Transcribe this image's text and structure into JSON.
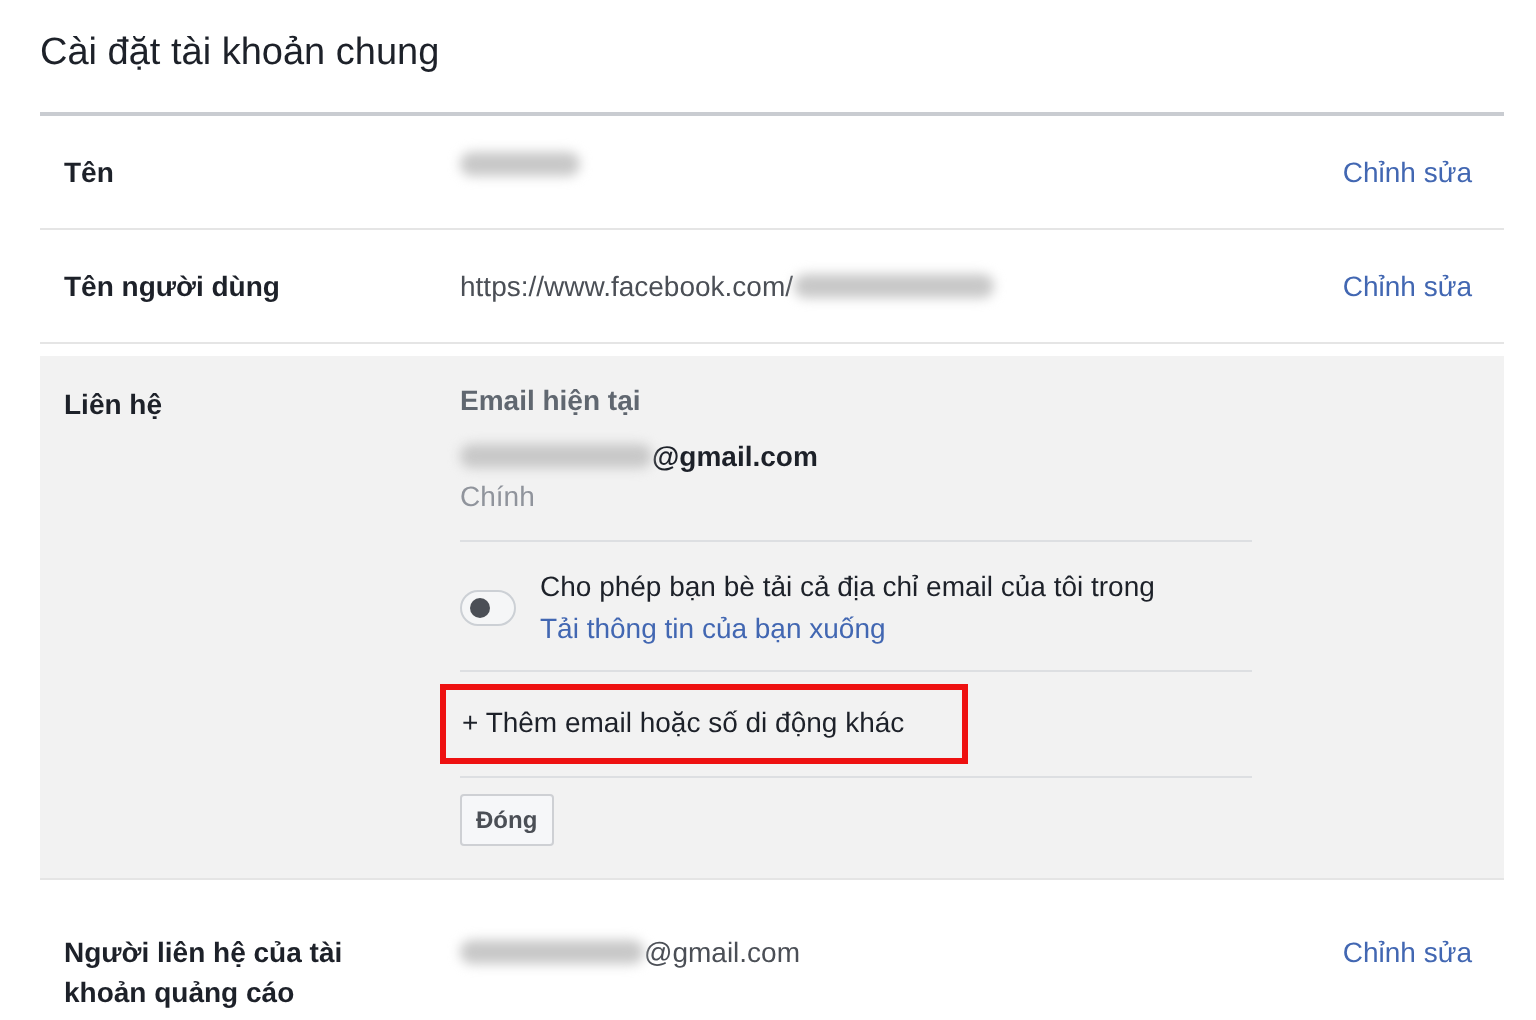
{
  "title": "Cài đặt tài khoản chung",
  "rows": [
    {
      "kind": "field",
      "label": "Tên",
      "blur_before": false,
      "blur_after": true,
      "edit": "Chỉnh sửa"
    },
    {
      "kind": "field",
      "label": "Tên người dùng",
      "value": "https://www.facebook.com/",
      "blur_before": false,
      "blur_after": true,
      "edit": "Chỉnh sửa"
    },
    {
      "kind": "contact",
      "label": "Liên hệ",
      "heading": "Email hiện tại",
      "email": "@gmail.com",
      "email_note": "Chính",
      "toggle": {
        "on": false,
        "text": "Cho phép bạn bè tải cả địa chỉ email của tôi trong ",
        "link": "Tải thông tin của bạn xuống"
      },
      "add": {
        "text": "+ Thêm email hoặc số di động khác",
        "highlighted": true
      },
      "close": "Đóng"
    },
    {
      "kind": "field",
      "label": "Người liên hệ của tài khoản quảng cáo",
      "value": "@gmail.com",
      "blur_before": true,
      "blur_after": false,
      "edit": "Chỉnh sửa"
    }
  ]
}
